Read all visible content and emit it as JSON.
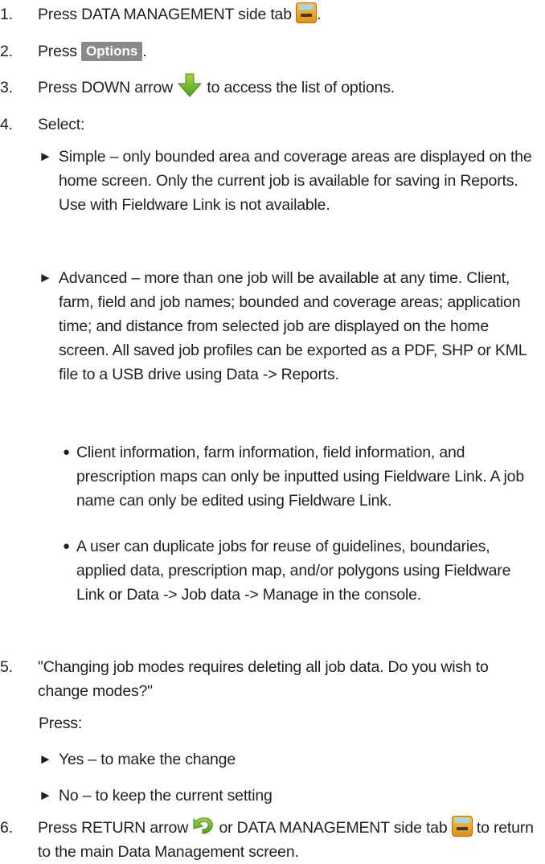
{
  "steps": [
    {
      "num": "1.",
      "before": "Press DATA MANAGEMENT side tab ",
      "icon": "data-management-tab-icon",
      "after": "."
    },
    {
      "num": "2.",
      "before": "Press ",
      "button": "Options",
      "after": "."
    },
    {
      "num": "3.",
      "before": "Press DOWN arrow ",
      "icon": "down-arrow-icon",
      "after": " to access the list of options."
    },
    {
      "num": "4.",
      "text": "Select:"
    },
    {
      "num": "5.",
      "text": "\"Changing job modes requires deleting all job data. Do you wish to change modes?\""
    },
    {
      "num": "6.",
      "before": "Press RETURN arrow ",
      "icon": "return-arrow-icon",
      "middle": " or DATA MANAGEMENT side tab ",
      "icon2": "data-management-tab-icon",
      "after": " to return to the main Data Management screen."
    }
  ],
  "select_options": [
    {
      "marker": "►",
      "text": "Simple – only bounded area and coverage areas are displayed on the home screen. Only the current job is available for saving in Reports. Use with Fieldware Link is not available."
    },
    {
      "marker": "►",
      "text": "Advanced – more than one job will be available at any time. Client, farm, field and job names; bounded and coverage areas; application time; and distance from selected job are displayed on the home screen. All saved job profiles can be exported as a PDF, SHP or KML file to a USB drive using Data -> Reports."
    }
  ],
  "advanced_bullets": [
    {
      "marker": "●",
      "text": "Client information, farm information, field information, and prescription maps can only be inputted using Fieldware Link. A job name can only be edited using Fieldware Link."
    },
    {
      "marker": "●",
      "text": "A user can duplicate jobs for reuse of guidelines, boundaries, applied data, prescription map, and/or polygons using Fieldware Link or Data -> Job data -> Manage in the console."
    }
  ],
  "press_label": "Press:",
  "confirm_options": [
    {
      "marker": "►",
      "text": "Yes – to make the change"
    },
    {
      "marker": "►",
      "text": "No – to keep the current setting"
    }
  ]
}
